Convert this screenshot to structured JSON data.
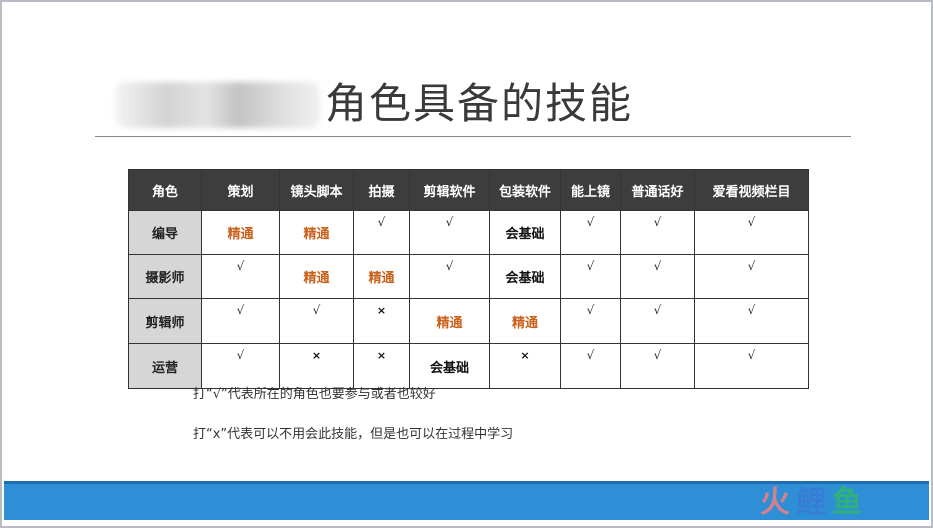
{
  "title": "角色具备的技能",
  "table": {
    "headers": [
      "角色",
      "策划",
      "镜头脚本",
      "拍摄",
      "剪辑软件",
      "包装软件",
      "能上镜",
      "普通话好",
      "爱看视频栏目"
    ],
    "rows": [
      {
        "role": "编导",
        "cells": [
          {
            "text": "精通",
            "kind": "orange"
          },
          {
            "text": "精通",
            "kind": "orange"
          },
          {
            "text": "√",
            "kind": "check"
          },
          {
            "text": "√",
            "kind": "check"
          },
          {
            "text": "会基础",
            "kind": "black"
          },
          {
            "text": "√",
            "kind": "check"
          },
          {
            "text": "√",
            "kind": "check"
          },
          {
            "text": "√",
            "kind": "check"
          }
        ]
      },
      {
        "role": "摄影师",
        "cells": [
          {
            "text": "√",
            "kind": "check"
          },
          {
            "text": "精通",
            "kind": "orange"
          },
          {
            "text": "精通",
            "kind": "orange"
          },
          {
            "text": "√",
            "kind": "check"
          },
          {
            "text": "会基础",
            "kind": "black"
          },
          {
            "text": "√",
            "kind": "check"
          },
          {
            "text": "√",
            "kind": "check"
          },
          {
            "text": "√",
            "kind": "check"
          }
        ]
      },
      {
        "role": "剪辑师",
        "cells": [
          {
            "text": "√",
            "kind": "check"
          },
          {
            "text": "√",
            "kind": "check"
          },
          {
            "text": "×",
            "kind": "cross"
          },
          {
            "text": "精通",
            "kind": "orange"
          },
          {
            "text": "精通",
            "kind": "orange"
          },
          {
            "text": "√",
            "kind": "check"
          },
          {
            "text": "√",
            "kind": "check"
          },
          {
            "text": "√",
            "kind": "check"
          }
        ]
      },
      {
        "role": "运营",
        "cells": [
          {
            "text": "√",
            "kind": "check"
          },
          {
            "text": "×",
            "kind": "cross"
          },
          {
            "text": "×",
            "kind": "cross"
          },
          {
            "text": "会基础",
            "kind": "black"
          },
          {
            "text": "×",
            "kind": "cross"
          },
          {
            "text": "√",
            "kind": "check"
          },
          {
            "text": "√",
            "kind": "check"
          },
          {
            "text": "√",
            "kind": "check"
          }
        ]
      }
    ]
  },
  "notes": [
    "打“√”代表所在的角色也要参与或者也较好",
    "打“x”代表可以不用会此技能，但是也可以在过程中学习"
  ],
  "colors": {
    "header_bg": "#3d3d3d",
    "role_bg": "#d6d6d6",
    "orange": "#c8621e",
    "footer_band": "#2e8ed6"
  },
  "logo": {
    "chars": [
      "火",
      "鲤",
      "鱼"
    ],
    "colors": [
      "#f08080",
      "#3a7bd5",
      "#2fb86b"
    ]
  }
}
